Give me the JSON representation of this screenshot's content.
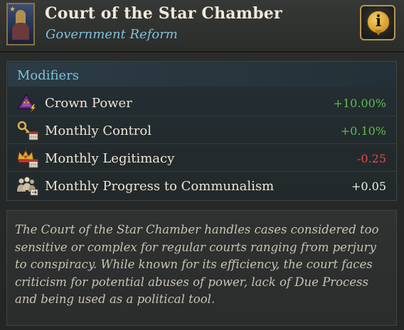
{
  "header": {
    "title": "Court of the Star Chamber",
    "subtitle": "Government Reform",
    "info_icon": "info-icon",
    "portrait_icon": "reform-portrait-icon"
  },
  "modifiers": {
    "title": "Modifiers",
    "items": [
      {
        "icon": "crown-power-icon",
        "label": "Crown Power",
        "value": "+10.00%",
        "color": "#5cbf4e"
      },
      {
        "icon": "key-calendar-icon",
        "label": "Monthly Control",
        "value": "+0.10%",
        "color": "#5cbf4e"
      },
      {
        "icon": "crown-calendar-icon",
        "label": "Monthly Legitimacy",
        "value": "-0.25",
        "color": "#e04a4a"
      },
      {
        "icon": "people-calendar-icon",
        "label": "Monthly Progress to Communalism",
        "value": "+0.05",
        "color": "#eeeeee"
      }
    ]
  },
  "description": {
    "text": "The Court of the Star Chamber handles cases considered too sensitive or complex for regular courts ranging from perjury to conspiracy. While known for its efficiency, the court faces criticism for potential abuses of power, lack of Due Process and being used as a political tool."
  },
  "colors": {
    "accent_blue": "#7ec1dc",
    "positive": "#5cbf4e",
    "negative": "#e04a4a",
    "neutral": "#eeeeee",
    "gold": "#b4984f"
  }
}
